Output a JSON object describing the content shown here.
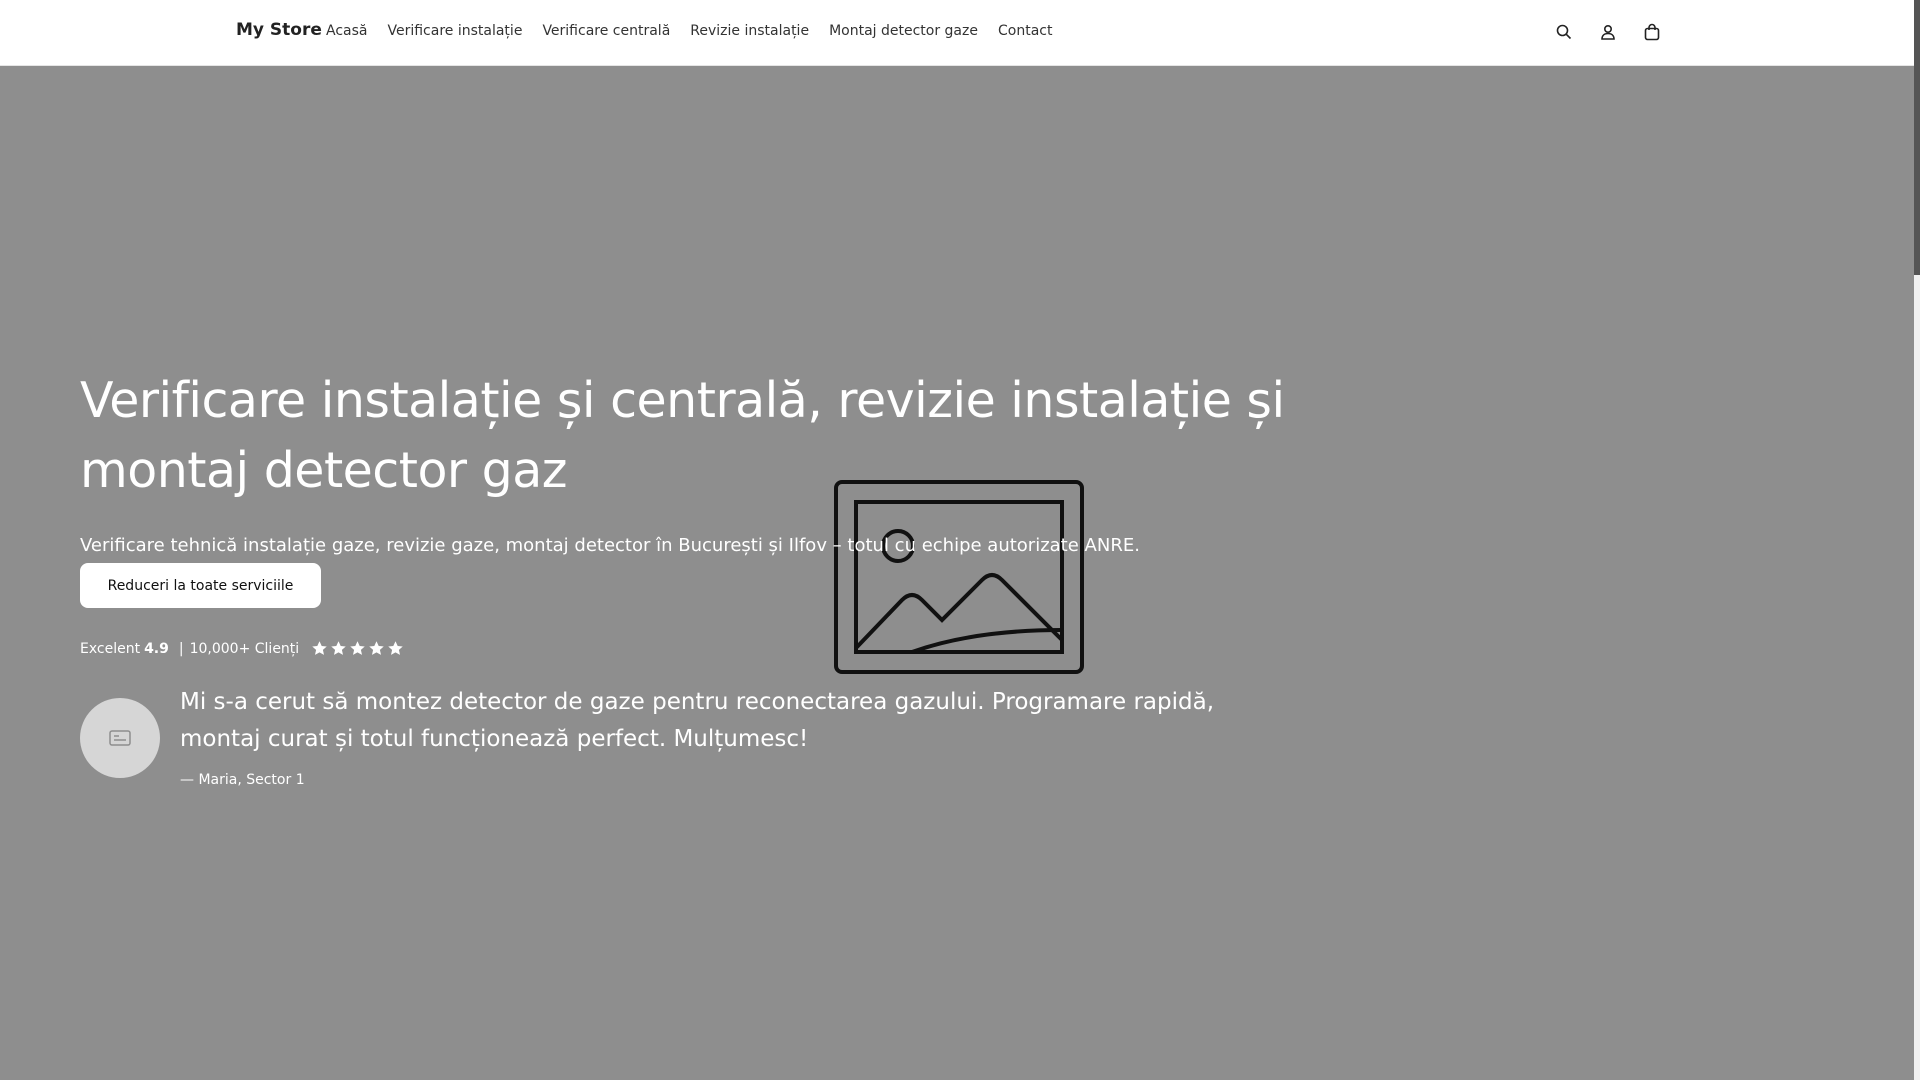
{
  "header": {
    "brand": "My Store",
    "nav": [
      "Acasă",
      "Verificare instalație",
      "Verificare centrală",
      "Revizie instalație",
      "Montaj detector gaze",
      "Contact"
    ],
    "icons": [
      "search-icon",
      "account-icon",
      "cart-icon"
    ]
  },
  "hero": {
    "title": "Verificare instalație și centrală, revizie instalație și montaj detector gaz",
    "subtitle": "Verificare tehnică instalație gaze, revizie gaze, montaj detector în București și Ilfov – totul cu echipe autorizate ANRE.",
    "cta": "Reduceri la toate serviciile",
    "rating": {
      "label": "Excelent",
      "score": "4.9",
      "separator": "|",
      "customers": "10,000+ Clienți",
      "stars": 5
    },
    "image_placeholder_icon": "image-placeholder-icon"
  },
  "testimonial": {
    "quote": "Mi s-a cerut să montez detector de gaze pentru reconectarea gazului. Programare rapidă, montaj curat și totul funcționează perfect. Mulțumesc!",
    "author": "— Maria, Sector 1",
    "avatar_icon": "avatar-placeholder-icon"
  },
  "colors": {
    "hero_background": "#8e8e8e",
    "header_background": "#ffffff",
    "text_light": "#ffffff",
    "button_background": "#ffffff"
  }
}
